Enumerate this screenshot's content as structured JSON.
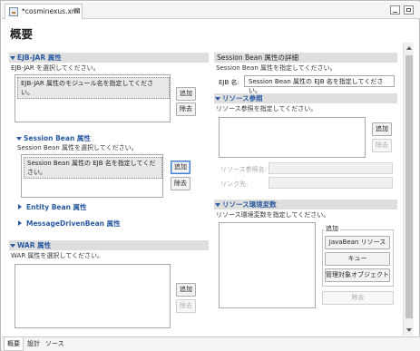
{
  "editor_tab": {
    "title": "*cosminexus.xml",
    "close": "⊠"
  },
  "page_title": "概要",
  "ejb_jar": {
    "header": "EJB-JAR 属性",
    "desc": "EJB-JAR を選択してください。",
    "list_items": [
      "EJB-JAR 属性のモジュール名を指定してください。"
    ],
    "add": "追加",
    "remove": "除去"
  },
  "session_bean_attr": {
    "header": "Session Bean 属性",
    "desc": "Session Bean 属性を選択してください。",
    "list_items": [
      "Session Bean 属性の EJB 名を指定してください。"
    ],
    "add": "追加",
    "remove": "除去"
  },
  "entity_bean": {
    "label": "Entity Bean 属性"
  },
  "mdb": {
    "label": "MessageDrivenBean 属性"
  },
  "war": {
    "header": "WAR 属性",
    "desc": "WAR 属性を選択してください。",
    "add": "追加",
    "remove": "除去"
  },
  "session_detail": {
    "header": "Session Bean 属性の詳細",
    "desc": "Session Bean 属性を指定してください。",
    "ejb_label": "EJB 名:",
    "ejb_value": "Session Bean 属性の EJB 名を指定してください。"
  },
  "resource_ref": {
    "header": "リソース参照",
    "desc": "リソース参照を指定してください。",
    "add": "追加",
    "remove": "除去",
    "ref_name_label": "リソース参照名:",
    "link_label": "リンク先:"
  },
  "resource_env": {
    "header": "リソース環境変数",
    "desc": "リソース環境変数を指定してください。",
    "group_label": "追加",
    "btn_javabean": "JavaBean リソース",
    "btn_queue": "キュー",
    "btn_managed": "管理対象オブジェクト",
    "remove": "除去"
  },
  "bottom_tabs": [
    "概要",
    "設計",
    "ソース"
  ],
  "colors": {
    "accent": "#2a5aa0",
    "section_bg": "#dedede",
    "focus": "#3b7fd4"
  }
}
